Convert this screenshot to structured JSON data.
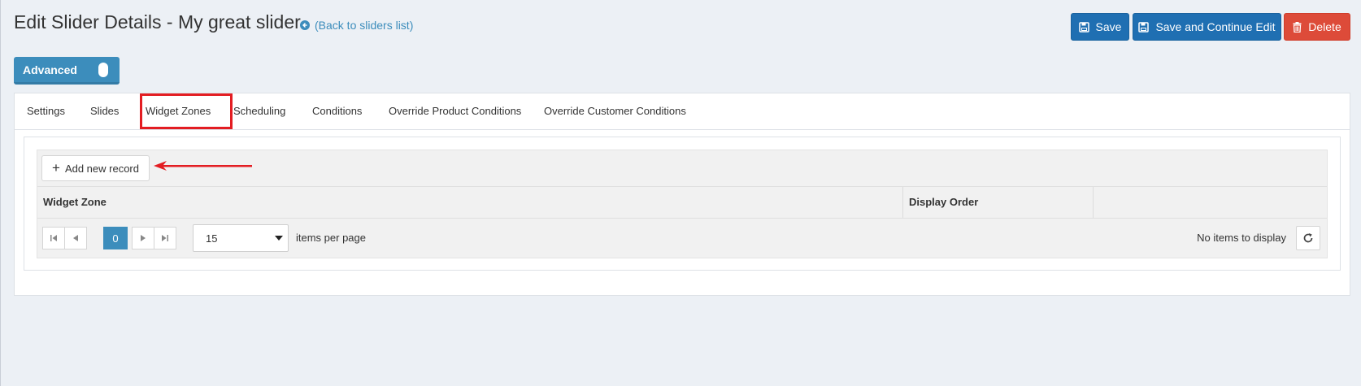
{
  "header": {
    "title": "Edit Slider Details - My great slider",
    "back_link": "(Back to sliders list)"
  },
  "actions": {
    "save": "Save",
    "save_continue": "Save and Continue Edit",
    "delete": "Delete"
  },
  "mode_toggle": {
    "label": "Advanced",
    "enabled": true
  },
  "tabs": [
    {
      "label": "Settings"
    },
    {
      "label": "Slides"
    },
    {
      "label": "Widget Zones",
      "active": true
    },
    {
      "label": "Scheduling"
    },
    {
      "label": "Conditions"
    },
    {
      "label": "Override Product Conditions"
    },
    {
      "label": "Override Customer Conditions"
    }
  ],
  "grid": {
    "add_button": "Add new record",
    "columns": [
      "Widget Zone",
      "Display Order",
      ""
    ],
    "pager": {
      "current_page": "0",
      "page_size": "15",
      "items_per_page_label": "items per page",
      "info": "No items to display"
    }
  },
  "colors": {
    "primary": "#1f6fb2",
    "danger": "#dd4b39",
    "accent": "#3c8dbc",
    "highlight": "#e31d22"
  }
}
